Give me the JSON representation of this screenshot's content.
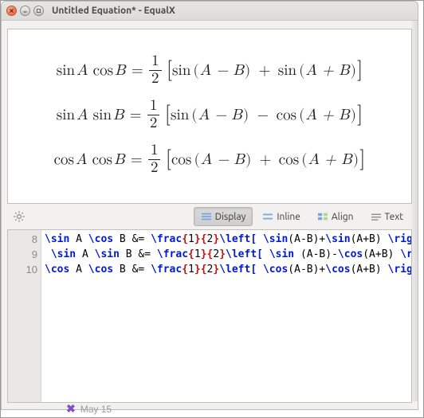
{
  "window": {
    "title": "Untitled Equation* - EqualX"
  },
  "preview": {
    "eq1_left_fn1": "sin",
    "eq1_left_var1": "A",
    "eq1_left_fn2": "cos",
    "eq1_left_var2": "B",
    "eq1_frac_num": "1",
    "eq1_frac_den": "2",
    "eq1_r1_fn": "sin",
    "eq1_r1_arg": "A − B",
    "eq1_r2_fn": "sin",
    "eq1_r2_arg": "A + B",
    "eq2_left_fn1": "sin",
    "eq2_left_var1": "A",
    "eq2_left_fn2": "sin",
    "eq2_left_var2": "B",
    "eq2_frac_num": "1",
    "eq2_frac_den": "2",
    "eq2_r1_fn": "sin",
    "eq2_r1_arg": "A − B",
    "eq2_r2_fn": "cos",
    "eq2_r2_arg": "A + B",
    "eq3_left_fn1": "cos",
    "eq3_left_var1": "A",
    "eq3_left_fn2": "cos",
    "eq3_left_var2": "B",
    "eq3_frac_num": "1",
    "eq3_frac_den": "2",
    "eq3_r1_fn": "cos",
    "eq3_r1_arg": "A − B",
    "eq3_r2_fn": "cos",
    "eq3_r2_arg": "A + B",
    "eq": "=",
    "plus": "+",
    "minus": "−"
  },
  "toolbar": {
    "display": "Display",
    "inline": "Inline",
    "align": "Align",
    "text": "Text"
  },
  "editor": {
    "lines": [
      "8",
      "9",
      "10"
    ],
    "l1": {
      "a": "\\sin",
      "b": " A ",
      "c": "\\cos",
      "d": " B &= ",
      "e": "\\frac",
      "f": "{",
      "g": "1",
      "h": "}{",
      "i": "2",
      "j": "}",
      "k": "\\left[",
      "l": " ",
      "m": "\\sin",
      "n": "(A-B)+",
      "o": "\\sin",
      "p": "(A+B) ",
      "q": "\\right]",
      "r": " ",
      "s": "\\\\"
    },
    "l2": {
      "a": " ",
      "b": "\\sin",
      "c": " A ",
      "d": "\\sin",
      "e": " B &= ",
      "f": "\\frac",
      "g": "{",
      "h": "1",
      "i": "}{",
      "j": "2",
      "k": "}",
      "l": "\\left[",
      "m": " ",
      "n": "\\sin",
      "o": " (A-B)-",
      "p": "\\cos",
      "q": "(A+B) ",
      "r": "\\right]",
      "s": " ",
      "t": "\\\\"
    },
    "l3": {
      "a": "\\cos",
      "b": " A ",
      "c": "\\cos",
      "d": " B &= ",
      "e": "\\frac",
      "f": "{",
      "g": "1",
      "h": "}{",
      "i": "2",
      "j": "}",
      "k": "\\left[",
      "l": " ",
      "m": "\\cos",
      "n": "(A-B)+",
      "o": "\\cos",
      "p": "(A+B) ",
      "q": "\\right]"
    }
  },
  "desktop_strip": {
    "glyph": "✖",
    "text": "May 15"
  }
}
